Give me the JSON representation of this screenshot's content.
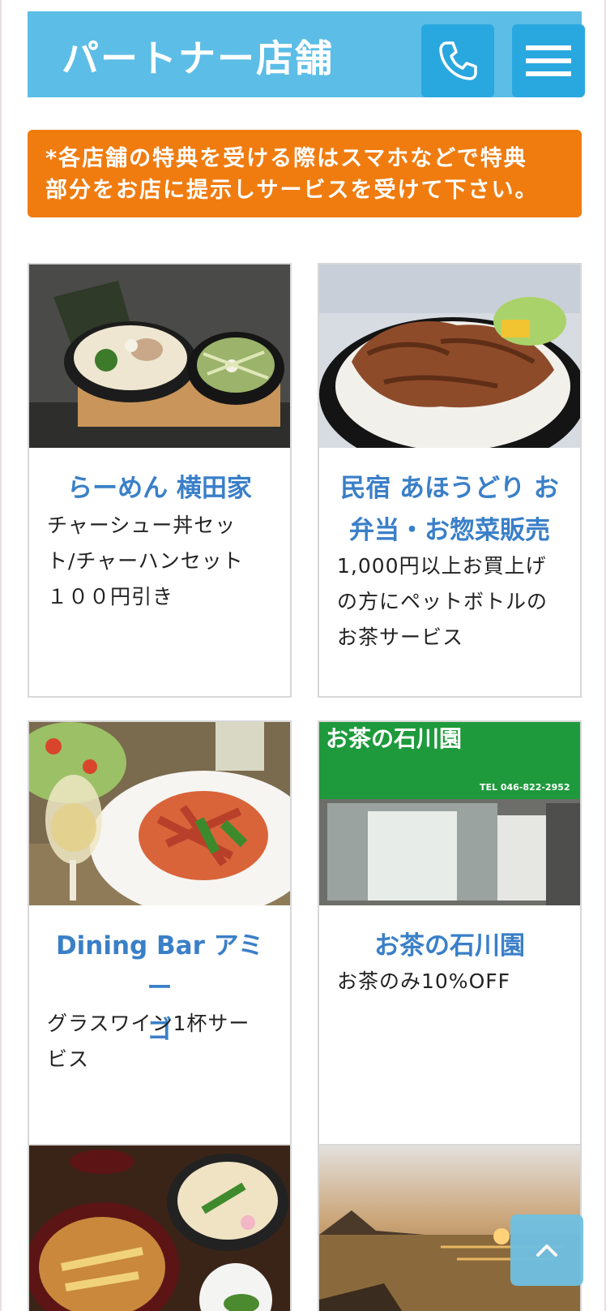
{
  "header": {
    "title": "パートナー店舗",
    "phone_icon": "phone-icon",
    "menu_icon": "hamburger-menu-icon"
  },
  "notice": {
    "line1": "*各店舗の特典を受ける際はスマホなどで特典",
    "line2": "部分をお店に提示しサービスを受けて下さい。"
  },
  "stores": [
    {
      "title": "らーめん 横田家",
      "desc_lines": [
        "チャーシュー丼セッ",
        "ト/チャーハンセット",
        "１００円引き"
      ]
    },
    {
      "title_lines": [
        "民宿 あほうどり お",
        "弁当・お惣菜販売"
      ],
      "desc_lines": [
        "1,000円以上お買上げ",
        "の方にペットボトルの",
        "お茶サービス"
      ]
    },
    {
      "title_lines": [
        "Dining Bar アミー",
        "ゴ"
      ],
      "desc_lines": [
        "グラスワイン1杯サー",
        "ビス"
      ]
    },
    {
      "title": "お茶の石川園",
      "desc_lines": [
        "お茶のみ10%OFF"
      ],
      "photo_sign": "お茶の石川園",
      "photo_tel": "TEL 046-822-2952"
    }
  ],
  "back_to_top_icon": "chevron-up-icon"
}
